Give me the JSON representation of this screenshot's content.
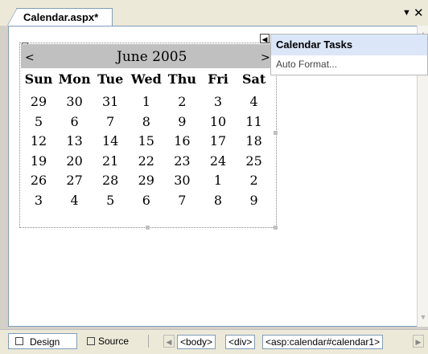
{
  "document_tab": {
    "title": "Calendar.aspx*",
    "dropdown_icon": "dropdown-arrow-icon",
    "close_icon": "close-icon"
  },
  "calendar": {
    "prev": "<",
    "month": "June 2005",
    "next": ">",
    "days_of_week": [
      "Sun",
      "Mon",
      "Tue",
      "Wed",
      "Thu",
      "Fri",
      "Sat"
    ],
    "weeks": [
      [
        "29",
        "30",
        "31",
        "1",
        "2",
        "3",
        "4"
      ],
      [
        "5",
        "6",
        "7",
        "8",
        "9",
        "10",
        "11"
      ],
      [
        "12",
        "13",
        "14",
        "15",
        "16",
        "17",
        "18"
      ],
      [
        "19",
        "20",
        "21",
        "22",
        "23",
        "24",
        "25"
      ],
      [
        "26",
        "27",
        "28",
        "29",
        "30",
        "1",
        "2"
      ],
      [
        "3",
        "4",
        "5",
        "6",
        "7",
        "8",
        "9"
      ]
    ]
  },
  "smart_tag": {
    "title": "Calendar Tasks",
    "items": [
      "Auto Format..."
    ],
    "toggle_icon": "smart-tag-toggle-icon"
  },
  "bottom": {
    "design_label": "Design",
    "source_label": "Source",
    "breadcrumbs": [
      "<body>",
      "<div>",
      "<asp:calendar#calendar1>"
    ]
  }
}
